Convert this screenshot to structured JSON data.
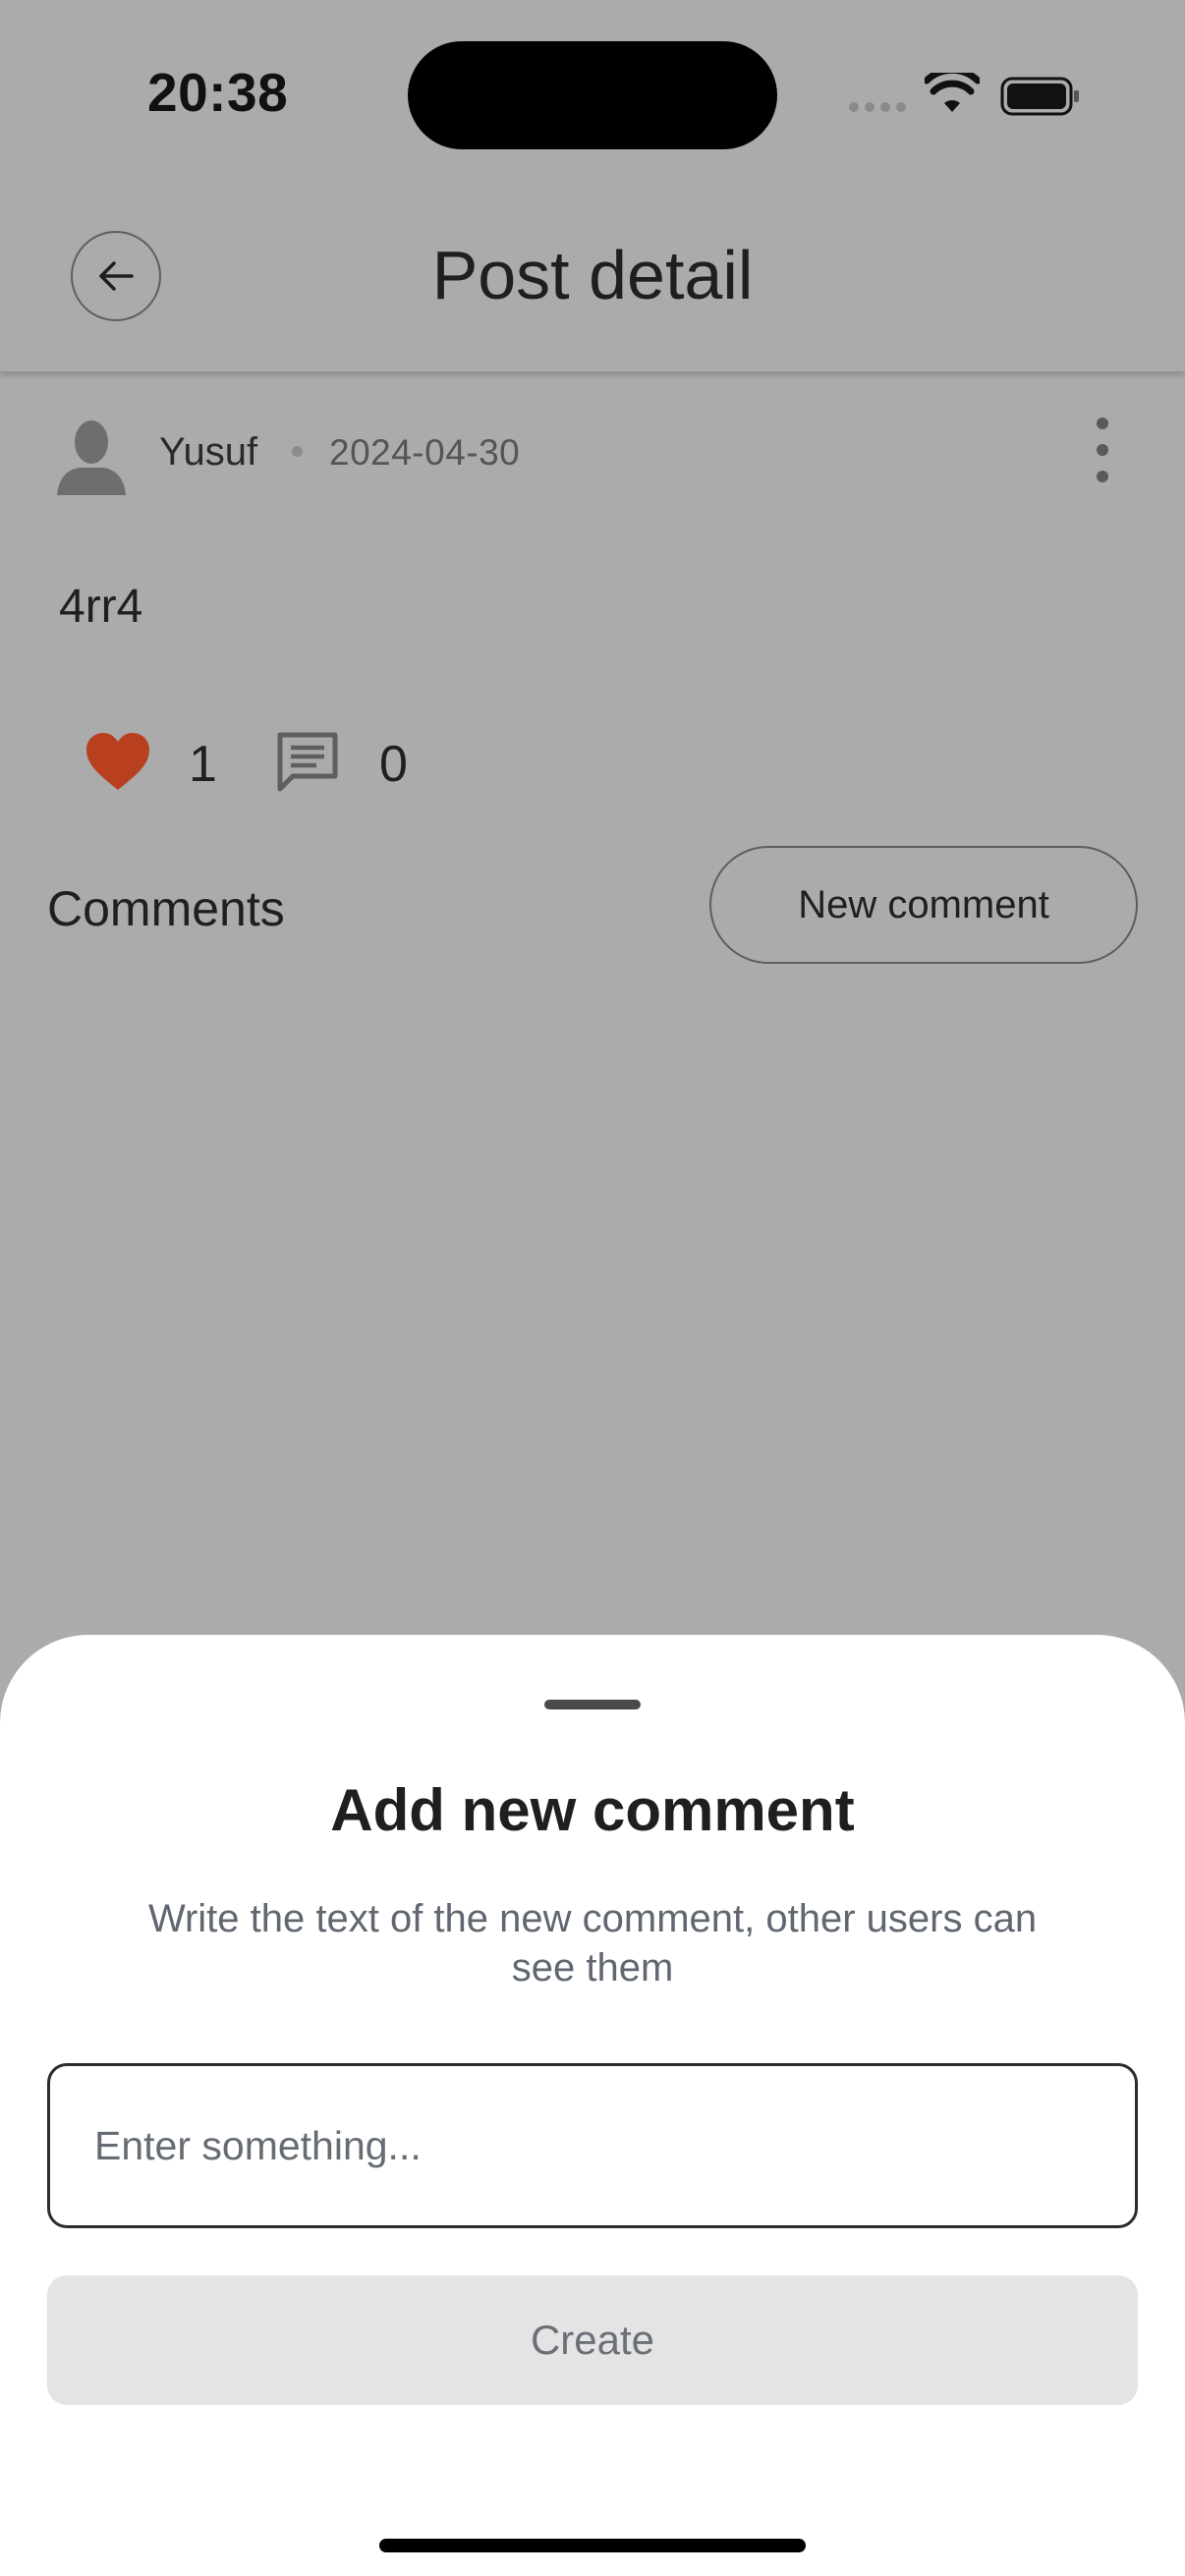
{
  "status_bar": {
    "time": "20:38"
  },
  "header": {
    "title": "Post detail"
  },
  "post": {
    "author": "Yusuf",
    "date": "2024-04-30",
    "text": "4rr4",
    "likes": "1",
    "comments": "0"
  },
  "comments_section": {
    "title": "Comments",
    "new_comment_label": "New comment"
  },
  "sheet": {
    "title": "Add new comment",
    "description": "Write the text of the new comment, other users can see them",
    "input_placeholder": "Enter something...",
    "input_value": "",
    "create_label": "Create"
  },
  "colors": {
    "overlay_bg": "#ababab",
    "heart": "#b8401f",
    "sheet_bg": "#ffffff",
    "disabled_button": "#e4e4e4"
  }
}
